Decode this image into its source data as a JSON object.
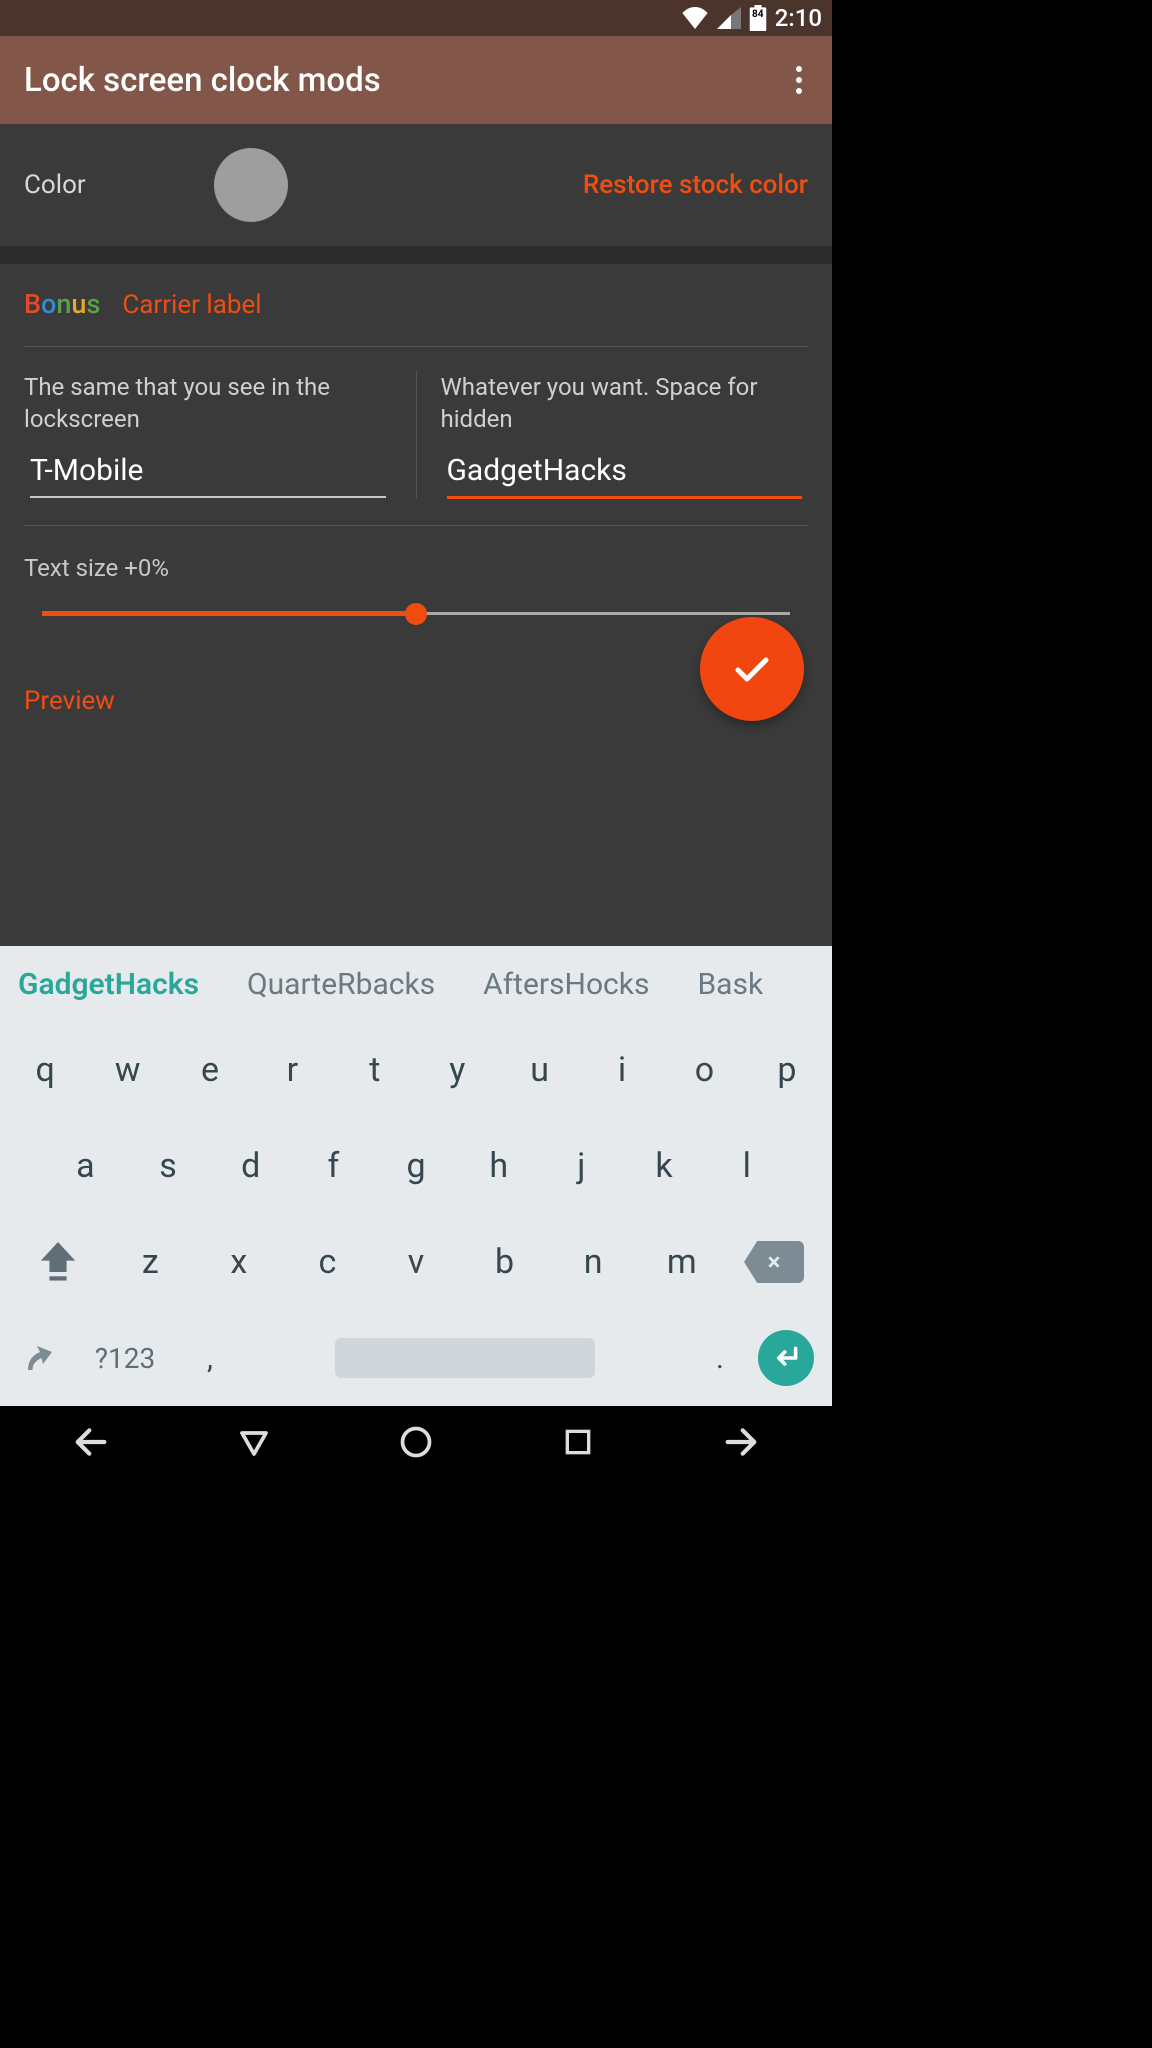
{
  "status": {
    "battery": "84",
    "time": "2:10"
  },
  "appbar": {
    "title": "Lock screen clock mods"
  },
  "color_section": {
    "label": "Color",
    "restore": "Restore stock color",
    "swatch_hex": "#9e9e9e"
  },
  "bonus": {
    "word": [
      "B",
      "o",
      "n",
      "u",
      "s"
    ],
    "section_title": "Carrier label",
    "left_desc": "The same that you see in the lockscreen",
    "left_value": "T-Mobile",
    "right_desc": "Whatever you want. Space for hidden",
    "right_value": "GadgetHacks",
    "text_size_label": "Text size +0%",
    "slider_percent": 50
  },
  "preview": {
    "title": "Preview"
  },
  "keyboard": {
    "suggestions": [
      "GadgetHacks",
      "QuarteRbacks",
      "AftersHocks",
      "Bask"
    ],
    "row1": [
      "q",
      "w",
      "e",
      "r",
      "t",
      "y",
      "u",
      "i",
      "o",
      "p"
    ],
    "row2": [
      "a",
      "s",
      "d",
      "f",
      "g",
      "h",
      "j",
      "k",
      "l"
    ],
    "row3": [
      "z",
      "x",
      "c",
      "v",
      "b",
      "n",
      "m"
    ],
    "sym": "?123"
  }
}
